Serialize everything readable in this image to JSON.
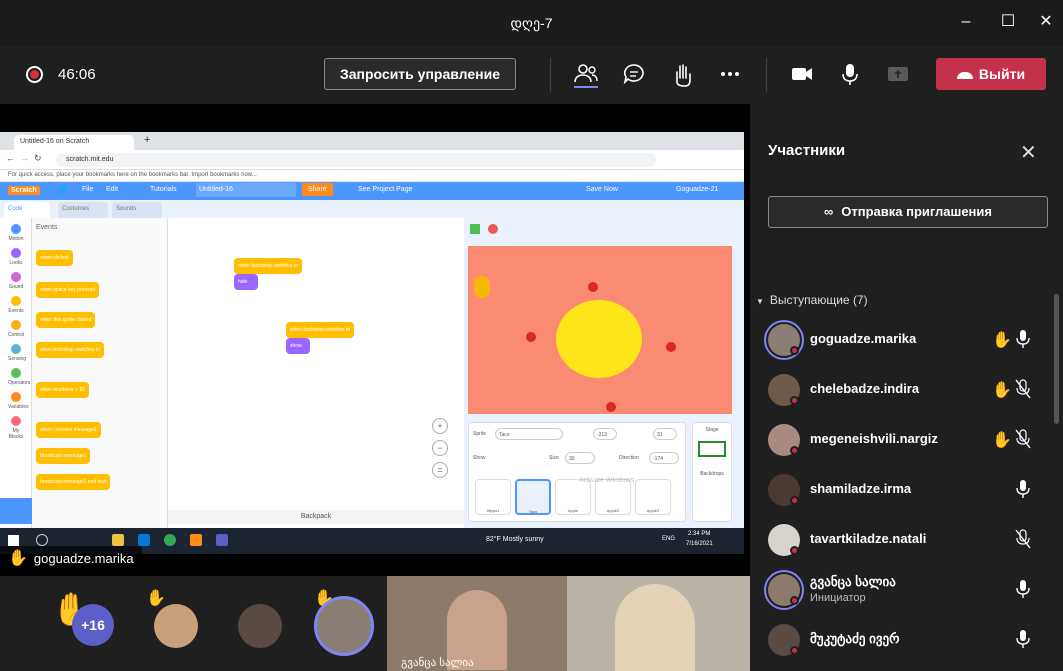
{
  "window": {
    "title": "დღე-7"
  },
  "toolbar": {
    "timer": "46:06",
    "request_control_label": "Запросить управление",
    "leave_label": "Выйти",
    "colors": {
      "leave": "#c4314b",
      "record": "#d13438",
      "accent": "#7f85f5"
    }
  },
  "shared_screen": {
    "browser_tab": "Untitled-16 on Scratch",
    "url": "scratch.mit.edu",
    "bookmarks_text": "For quick access, place your bookmarks here on the bookmarks bar. Import bookmarks now...",
    "scratch_menu": [
      "File",
      "Edit",
      "Tutorials",
      "Untitled-16",
      "Share",
      "See Project Page",
      "Save Now",
      "Goguadze-21"
    ],
    "editor_tabs": [
      "Code",
      "Costumes",
      "Sounds"
    ],
    "categories": [
      "Motion",
      "Looks",
      "Sound",
      "Events",
      "Control",
      "Sensing",
      "Operators",
      "Variables",
      "My Blocks"
    ],
    "palette_title": "Events",
    "palette_blocks": [
      "when clicked",
      "when space key pressed",
      "when this sprite clicked",
      "when backdrop switches to",
      "when loudness > 10",
      "when I receive message1",
      "broadcast message1",
      "broadcast message1 and wait"
    ],
    "script_blocks": [
      {
        "hat": "when backdrop switches to",
        "action": "hide"
      },
      {
        "hat": "when backdrop switches to",
        "action": "show"
      }
    ],
    "sprite_info": {
      "sprite_label": "Sprite",
      "sprite_name": "Taco",
      "x": "-213",
      "y": "31",
      "show_label": "Show",
      "size_label": "Size",
      "size": "30",
      "direction_label": "Direction",
      "direction": "-174"
    },
    "sprites": [
      "Hippo1",
      "Taco",
      "Apple",
      "Apple2",
      "Apple3"
    ],
    "stage_label": "Stage",
    "backdrops_label": "Backdrops",
    "backpack_label": "Backpack",
    "windows_activation": "Activate Windows",
    "taskbar": {
      "weather": "82°F  Mostly sunny",
      "lang": "ENG",
      "time": "2:34 PM",
      "date": "7/16/2021"
    }
  },
  "raised_hand_name": "goguadze.marika",
  "bottom_strip": {
    "more_count": "+16",
    "video_label": "გვანცა სალია"
  },
  "panel": {
    "title": "Участники",
    "invite_label": "Отправка приглашения",
    "presenters_heading": "Выступающие (7)",
    "participants": [
      {
        "name": "goguadze.marika",
        "role": "",
        "hand": true,
        "mic": "on"
      },
      {
        "name": "chelebadze.indira",
        "role": "",
        "hand": true,
        "mic": "muted"
      },
      {
        "name": "megeneishvili.nargiz",
        "role": "",
        "hand": true,
        "mic": "muted"
      },
      {
        "name": "shamiladze.irma",
        "role": "",
        "hand": false,
        "mic": "on"
      },
      {
        "name": "tavartkiladze.natali",
        "role": "",
        "hand": false,
        "mic": "muted"
      },
      {
        "name": "გვანცა სალია",
        "role": "Инициатор",
        "hand": false,
        "mic": "on"
      },
      {
        "name": "მუკუტაძე ივერ",
        "role": "",
        "hand": false,
        "mic": "on"
      }
    ]
  }
}
